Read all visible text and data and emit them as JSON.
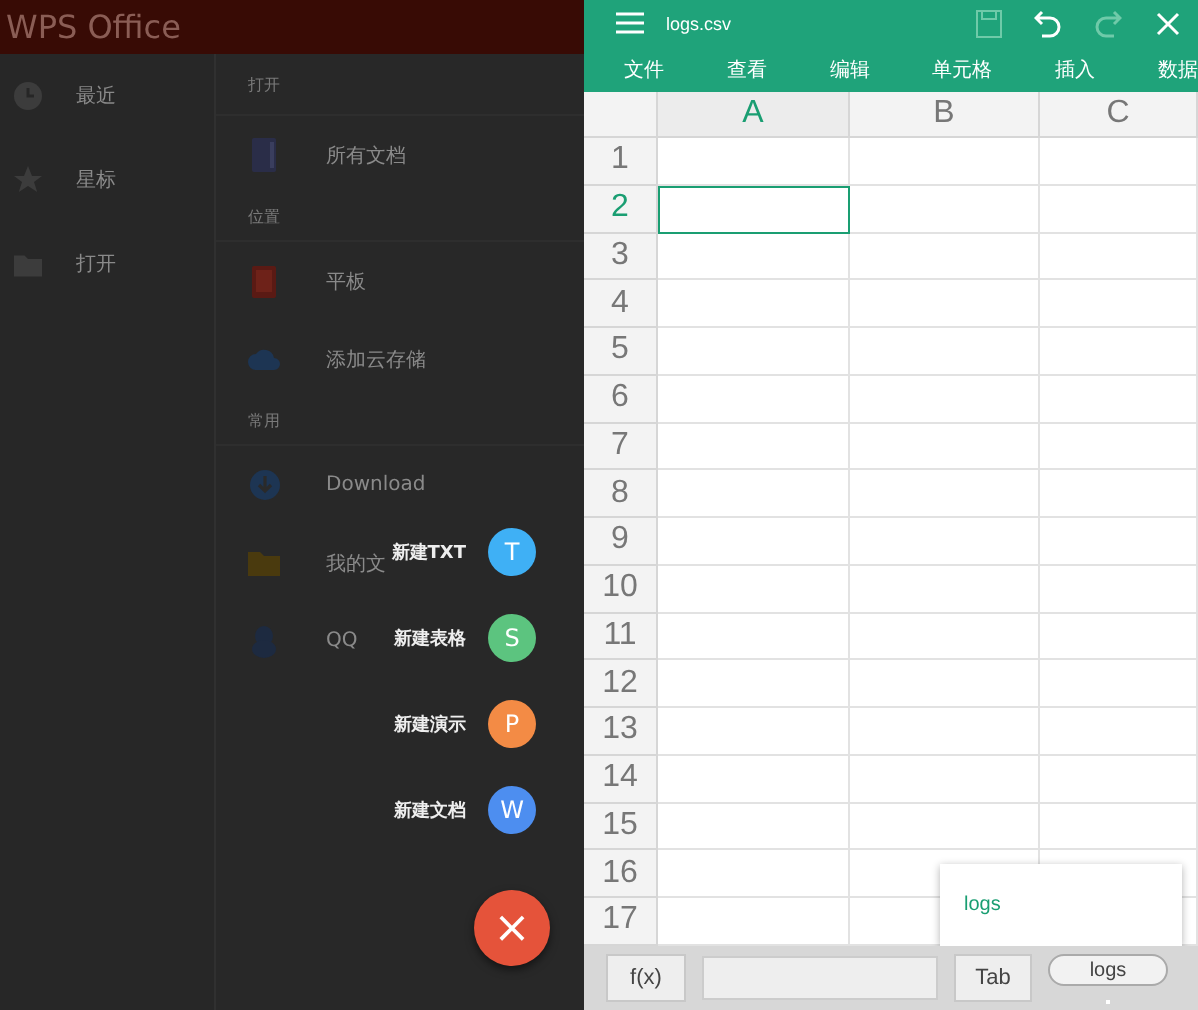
{
  "home": {
    "app_title": "WPS Office",
    "nav": [
      {
        "label": "最近",
        "kind": "clock"
      },
      {
        "label": "星标",
        "kind": "star"
      },
      {
        "label": "打开",
        "kind": "folder"
      }
    ],
    "sections": [
      {
        "header": "打开",
        "items": [
          {
            "label": "所有文档",
            "kind": "document"
          }
        ]
      },
      {
        "header": "位置",
        "items": [
          {
            "label": "平板",
            "kind": "tablet"
          },
          {
            "label": "添加云存储",
            "kind": "cloud"
          }
        ]
      },
      {
        "header": "常用",
        "items": [
          {
            "label": "Download",
            "kind": "download"
          },
          {
            "label": "我的文",
            "kind": "folder"
          },
          {
            "label": "QQ",
            "kind": "figure"
          }
        ]
      }
    ],
    "fab_menu": [
      {
        "label": "新建TXT",
        "letter": "T",
        "color": "#3fb0f5"
      },
      {
        "label": "新建表格",
        "letter": "S",
        "color": "#5cc47f"
      },
      {
        "label": "新建演示",
        "letter": "P",
        "color": "#f38b45"
      },
      {
        "label": "新建文档",
        "letter": "W",
        "color": "#4d8ef0"
      }
    ],
    "fab_close": "×"
  },
  "sheet": {
    "file_name": "logs.csv",
    "toolbar": [
      {
        "kind": "save",
        "disabled": true
      },
      {
        "kind": "undo",
        "disabled": false
      },
      {
        "kind": "redo",
        "disabled": true
      },
      {
        "kind": "close",
        "disabled": false
      }
    ],
    "menu": [
      "文件",
      "查看",
      "编辑",
      "单元格",
      "插入",
      "数据"
    ],
    "columns": [
      {
        "label": "A",
        "selected": true
      },
      {
        "label": "B",
        "selected": false
      },
      {
        "label": "C",
        "selected": false
      }
    ],
    "rows": [
      {
        "label": "1",
        "selected": false
      },
      {
        "label": "2",
        "selected": true
      },
      {
        "label": "3",
        "selected": false
      },
      {
        "label": "4",
        "selected": false
      },
      {
        "label": "5",
        "selected": false
      },
      {
        "label": "6",
        "selected": false
      },
      {
        "label": "7",
        "selected": false
      },
      {
        "label": "8",
        "selected": false
      },
      {
        "label": "9",
        "selected": false
      },
      {
        "label": "10",
        "selected": false
      },
      {
        "label": "11",
        "selected": false
      },
      {
        "label": "12",
        "selected": false
      },
      {
        "label": "13",
        "selected": false
      },
      {
        "label": "14",
        "selected": false
      },
      {
        "label": "15",
        "selected": false
      },
      {
        "label": "16",
        "selected": false
      },
      {
        "label": "17",
        "selected": false
      }
    ],
    "fx_button": "f(x)",
    "tab_button": "Tab",
    "sheet_tabs": [
      "logs"
    ],
    "popup_items": [
      "logs"
    ]
  }
}
